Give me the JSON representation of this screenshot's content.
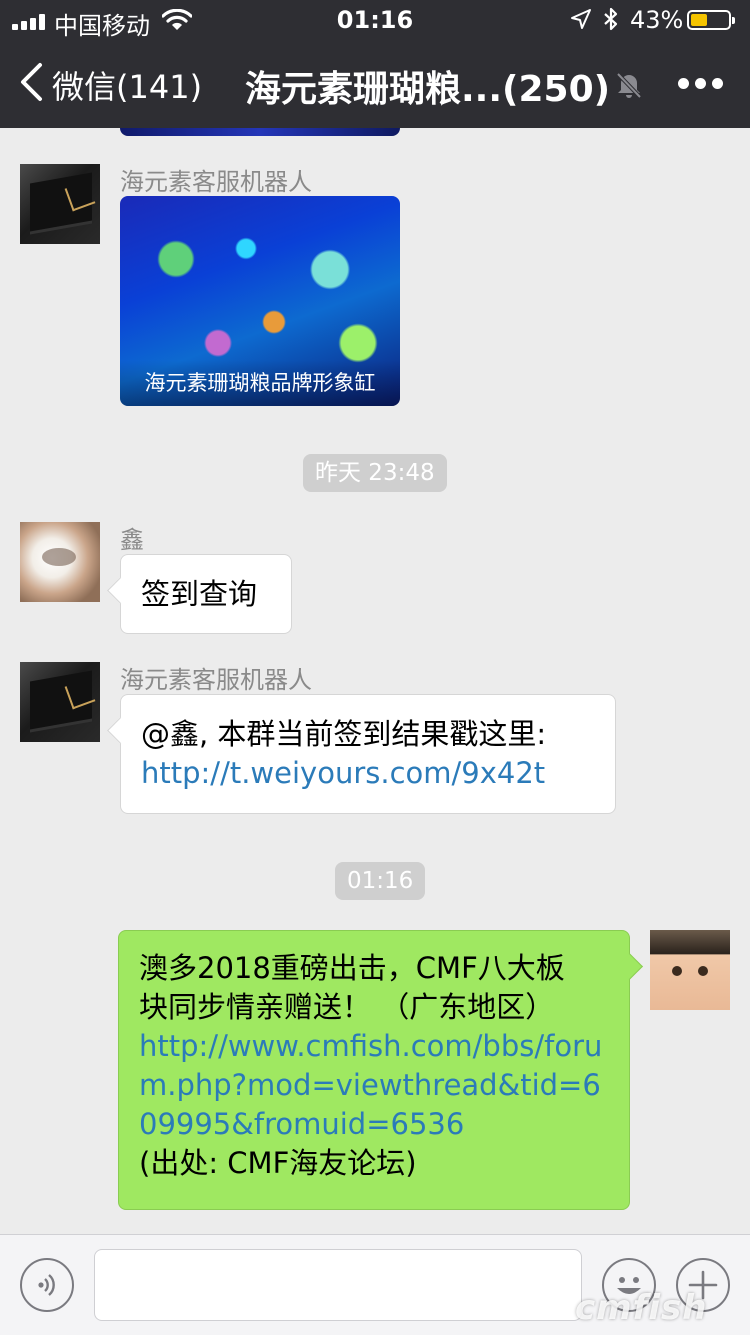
{
  "status_bar": {
    "carrier": "中国移动",
    "time": "01:16",
    "battery_percent": "43%",
    "battery_level": 0.43,
    "battery_color": "#f5c400"
  },
  "header": {
    "back_label": "微信(141)",
    "title": "海元素珊瑚粮...(250)",
    "icons": [
      "chevron-left-icon",
      "bell-muted-icon",
      "more-icon"
    ],
    "background": "#2e2e33"
  },
  "messages": {
    "m1": {
      "sender": "海元素客服机器人",
      "image_caption": "海元素珊瑚粮品牌形象缸"
    },
    "ts1": "昨天 23:48",
    "m2": {
      "sender": "鑫",
      "text": "签到查询"
    },
    "m3": {
      "sender": "海元素客服机器人",
      "text": "@鑫, 本群当前签到结果戳这里:",
      "link": "http://t.weiyours.com/9x42t"
    },
    "ts2": "01:16",
    "m4": {
      "text_line1": "澳多2018重磅出击，CMF八大板",
      "text_line2": "块同步情亲赠送！ （广东地区）",
      "link": "http://www.cmfish.com/bbs/forum.php?mod=viewthread&tid=609995&fromuid=6536",
      "source": "(出处: CMF海友论坛)",
      "bubble_color": "#9fe861"
    }
  },
  "input_bar": {
    "icons": [
      "voice-icon",
      "emoji-icon",
      "plus-icon"
    ]
  },
  "watermark": "cmfish"
}
